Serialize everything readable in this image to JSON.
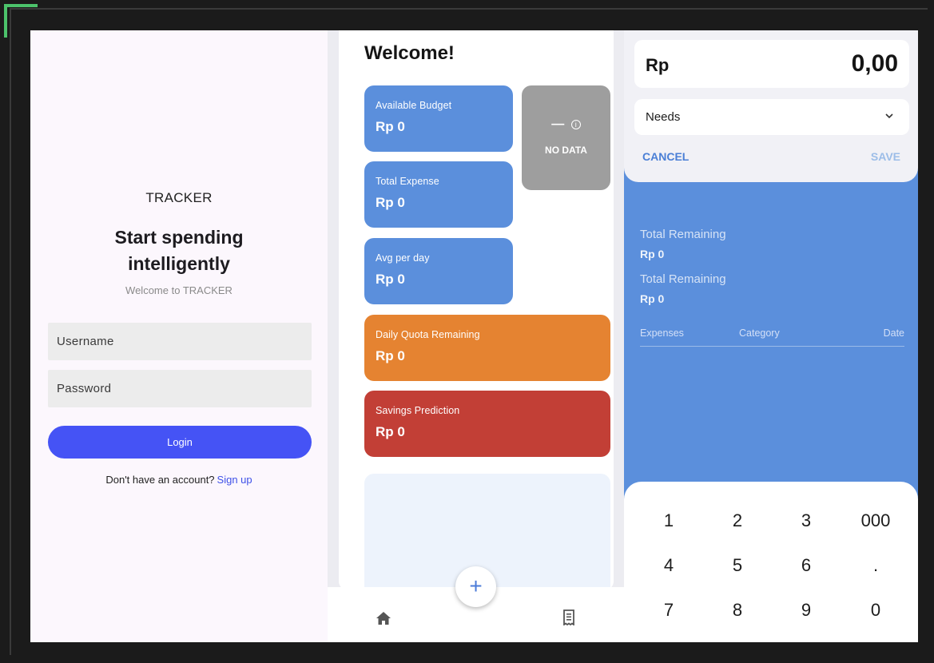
{
  "login": {
    "brand": "TRACKER",
    "headline_line1": "Start spending",
    "headline_line2": "intelligently",
    "subtitle": "Welcome to TRACKER",
    "username_placeholder": "Username",
    "password_placeholder": "Password",
    "login_label": "Login",
    "signup_prompt": "Don't have an account?",
    "signup_link": "Sign up"
  },
  "dashboard": {
    "welcome": "Welcome!",
    "cards": [
      {
        "label": "Available Budget",
        "value": "Rp 0"
      },
      {
        "label": "Total Expense",
        "value": "Rp 0"
      },
      {
        "label": "Avg per day",
        "value": "Rp 0"
      },
      {
        "label": "Daily Quota Remaining",
        "value": "Rp 0"
      },
      {
        "label": "Savings Prediction",
        "value": "Rp 0"
      }
    ],
    "no_data": {
      "dash": "—",
      "info": "i",
      "text": "NO DATA"
    },
    "fab_label": "+",
    "nav": {
      "home_icon": "home-icon",
      "receipt_icon": "receipt-icon"
    }
  },
  "entry": {
    "currency": "Rp",
    "amount": "0,00",
    "category": "Needs",
    "cancel": "CANCEL",
    "save": "SAVE",
    "summary": [
      {
        "label": "Total Remaining",
        "value": "Rp 0"
      },
      {
        "label": "Total Remaining",
        "value": "Rp 0"
      }
    ],
    "columns": [
      "Expenses",
      "Category",
      "Date"
    ],
    "keys": [
      "1",
      "2",
      "3",
      "000",
      "4",
      "5",
      "6",
      ".",
      "7",
      "8",
      "9",
      "0"
    ]
  },
  "colors": {
    "primary_blue": "#5b8fdc",
    "login_button": "#4553f5",
    "orange": "#e58331",
    "red": "#c23f36",
    "gray": "#9e9e9e"
  }
}
